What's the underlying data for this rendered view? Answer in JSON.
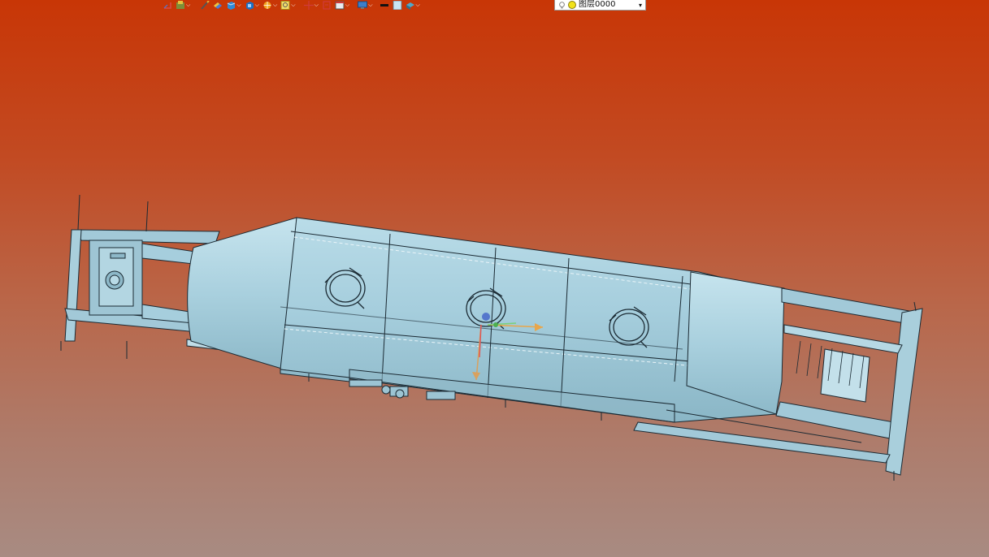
{
  "toolbar": {
    "items": [
      {
        "icon": "exit-sketch-icon"
      },
      {
        "icon": "layer-settings-icon",
        "has_dropdown": true
      },
      {
        "icon": "pencil-icon"
      },
      {
        "icon": "paint-bucket-icon"
      },
      {
        "icon": "solid-box-icon",
        "has_dropdown": true
      },
      {
        "icon": "box-view-icon",
        "has_dropdown": true
      },
      {
        "icon": "sun-render-icon",
        "has_dropdown": true
      },
      {
        "icon": "zoom-fit-icon",
        "has_dropdown": true
      },
      {
        "icon": "move-axis-icon",
        "has_dropdown": true
      },
      {
        "icon": "rotate-icon"
      },
      {
        "icon": "window-icon",
        "has_dropdown": true
      },
      {
        "icon": "display-monitor-icon",
        "has_dropdown": true
      },
      {
        "icon": "line-color-icon"
      },
      {
        "icon": "fill-color-icon"
      },
      {
        "icon": "material-icon",
        "has_dropdown": true
      }
    ],
    "colors": {
      "line_color": "#111111",
      "fill_color": "#c9e6f4"
    },
    "layer_select": {
      "value": "图层0000",
      "bulb_icon": "light-bulb-icon",
      "status_icon": "yellow-dot-icon"
    }
  },
  "viewport": {
    "model": "tank-trailer-3d-model",
    "background_top": "#c83606",
    "background_bottom": "#a88b82",
    "model_color": "#a6cedd",
    "edge_color": "#1b2a33",
    "axis_triad": {
      "x_color": "#e8a64a",
      "y_color": "#7ad07a",
      "z_color": "#d9a15e",
      "origin_color": "#5577cc"
    }
  }
}
